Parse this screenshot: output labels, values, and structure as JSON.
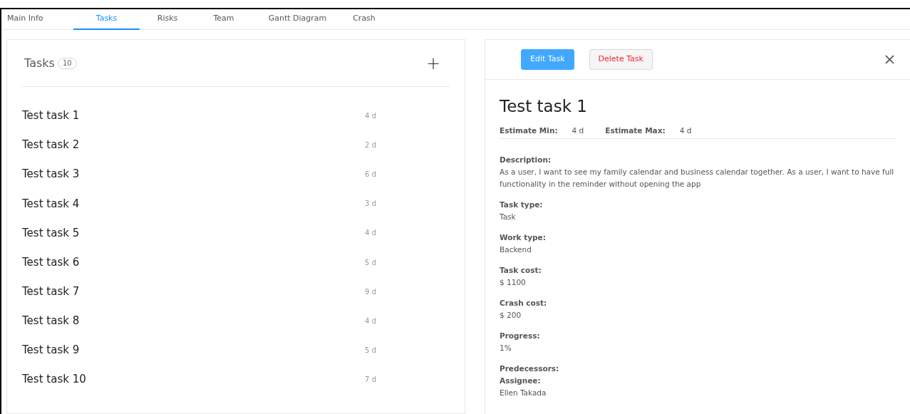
{
  "tabs": [
    {
      "label": "Main Info",
      "selected": false
    },
    {
      "label": "Tasks",
      "selected": true
    },
    {
      "label": "Risks",
      "selected": false
    },
    {
      "label": "Team",
      "selected": false
    },
    {
      "label": "Gantt Diagram",
      "selected": false
    },
    {
      "label": "Crash",
      "selected": false
    }
  ],
  "task_list": {
    "title": "Tasks",
    "count": "10",
    "add_icon": "+",
    "items": [
      {
        "name": "Test task 1",
        "duration": "4 d"
      },
      {
        "name": "Test task 2",
        "duration": "2 d"
      },
      {
        "name": "Test task 3",
        "duration": "6 d"
      },
      {
        "name": "Test task 4",
        "duration": "3 d"
      },
      {
        "name": "Test task 5",
        "duration": "4 d"
      },
      {
        "name": "Test task 6",
        "duration": "5 d"
      },
      {
        "name": "Test task 7",
        "duration": "9 d"
      },
      {
        "name": "Test task 8",
        "duration": "4 d"
      },
      {
        "name": "Test task 9",
        "duration": "5 d"
      },
      {
        "name": "Test task 10",
        "duration": "7 d"
      }
    ]
  },
  "detail": {
    "buttons": [
      {
        "label": "Edit Task",
        "kind": "primary"
      },
      {
        "label": "Delete Task",
        "kind": "danger"
      }
    ],
    "title": "Test task 1",
    "estimates": [
      {
        "label": "Estimate Min:",
        "value": "4 d"
      },
      {
        "label": "Estimate Max:",
        "value": "4 d"
      }
    ],
    "fields": [
      {
        "label": "Description:",
        "value": "As a user, I want to see my family calendar and business calendar together. As a user, I want to have full functionality in the reminder without opening the app"
      },
      {
        "label": "Task type:",
        "value": "Task"
      },
      {
        "label": "Work type:",
        "value": "Backend"
      },
      {
        "label": "Task cost:",
        "value": "$ 1100"
      },
      {
        "label": "Crash cost:",
        "value": "$ 200"
      },
      {
        "label": "Progress:",
        "value": "1%"
      },
      {
        "label": "Predecessors:"
      },
      {
        "label": "Assignee:",
        "value": "Ellen Takada"
      }
    ]
  }
}
